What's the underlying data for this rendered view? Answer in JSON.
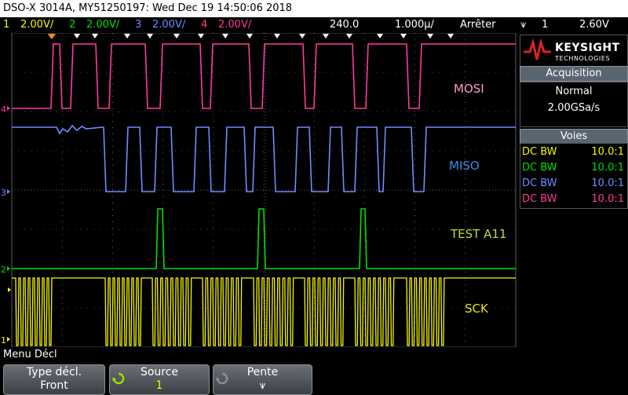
{
  "title": "DSO-X 3014A, MY51250197: Wed Dec 19 14:50:06 2018",
  "status": {
    "ch1": {
      "num": "1",
      "scale": "2.00V/",
      "color": "#f7f700"
    },
    "ch2": {
      "num": "2",
      "scale": "2.00V/",
      "color": "#00e000"
    },
    "ch3": {
      "num": "3",
      "scale": "2.00V/",
      "color": "#6e8cff"
    },
    "ch4": {
      "num": "4",
      "scale": "2.00V/",
      "color": "#ff3a9a"
    },
    "delay": "240.0͸",
    "timebase": "1.000µ/",
    "run_state": "Arrêter",
    "trig_symbol": "⩛",
    "trig_channel": "1",
    "trig_level": "2.60V"
  },
  "labels": {
    "mosi": "MOSI",
    "miso": "MISO",
    "test": "TEST A11",
    "sck": "SCK"
  },
  "ground_markers": {
    "m4": "4",
    "m3": "3",
    "m2": "2",
    "m1": "1"
  },
  "logo": {
    "brand": "KEYSIGHT",
    "sub": "TECHNOLOGIES"
  },
  "acquisition": {
    "header": "Acquisition",
    "mode": "Normal",
    "rate": "2.00GSa/s"
  },
  "voies": {
    "header": "Voies",
    "rows": [
      {
        "coupling": "DC BW",
        "ratio": "10.0:1",
        "color": "#f7f700"
      },
      {
        "coupling": "DC BW",
        "ratio": "10.0:1",
        "color": "#00e000"
      },
      {
        "coupling": "DC BW",
        "ratio": "10.0:1",
        "color": "#6e8cff"
      },
      {
        "coupling": "DC BW",
        "ratio": "10.0:1",
        "color": "#ff3a9a"
      }
    ]
  },
  "menu": {
    "title": "Menu Décl",
    "softkeys": [
      {
        "label": "Type décl.",
        "value": "Front"
      },
      {
        "label": "Source",
        "value": "1"
      },
      {
        "label": "Pente",
        "value": "⩛"
      }
    ]
  },
  "colors": {
    "ch1": "#f7f700",
    "ch2": "#00e000",
    "ch3": "#6e8cff",
    "ch4": "#ff3a9a",
    "grid": "#9a9a9a",
    "label_mosi": "#ff9ac8",
    "label_miso": "#3d8be6",
    "label_test": "#b8e030",
    "label_sck": "#e8e800"
  }
}
